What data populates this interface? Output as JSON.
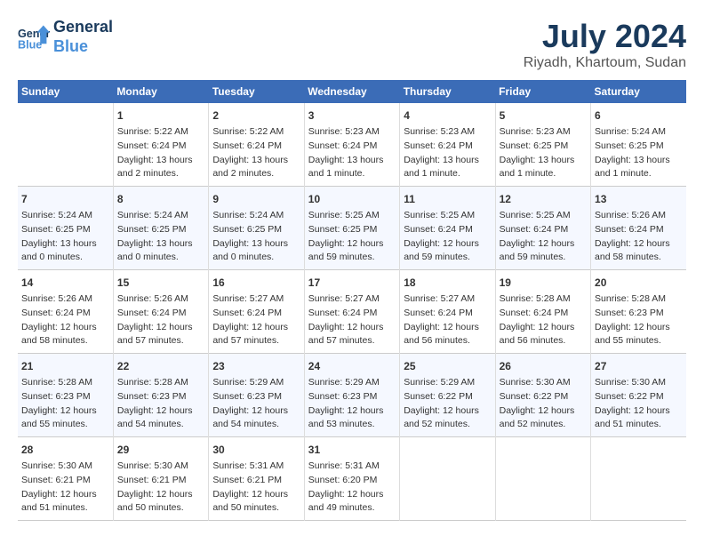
{
  "header": {
    "logo_line1": "General",
    "logo_line2": "Blue",
    "month": "July 2024",
    "location": "Riyadh, Khartoum, Sudan"
  },
  "columns": [
    "Sunday",
    "Monday",
    "Tuesday",
    "Wednesday",
    "Thursday",
    "Friday",
    "Saturday"
  ],
  "weeks": [
    [
      {
        "day": "",
        "info": ""
      },
      {
        "day": "1",
        "info": "Sunrise: 5:22 AM\nSunset: 6:24 PM\nDaylight: 13 hours\nand 2 minutes."
      },
      {
        "day": "2",
        "info": "Sunrise: 5:22 AM\nSunset: 6:24 PM\nDaylight: 13 hours\nand 2 minutes."
      },
      {
        "day": "3",
        "info": "Sunrise: 5:23 AM\nSunset: 6:24 PM\nDaylight: 13 hours\nand 1 minute."
      },
      {
        "day": "4",
        "info": "Sunrise: 5:23 AM\nSunset: 6:24 PM\nDaylight: 13 hours\nand 1 minute."
      },
      {
        "day": "5",
        "info": "Sunrise: 5:23 AM\nSunset: 6:25 PM\nDaylight: 13 hours\nand 1 minute."
      },
      {
        "day": "6",
        "info": "Sunrise: 5:24 AM\nSunset: 6:25 PM\nDaylight: 13 hours\nand 1 minute."
      }
    ],
    [
      {
        "day": "7",
        "info": "Sunrise: 5:24 AM\nSunset: 6:25 PM\nDaylight: 13 hours\nand 0 minutes."
      },
      {
        "day": "8",
        "info": "Sunrise: 5:24 AM\nSunset: 6:25 PM\nDaylight: 13 hours\nand 0 minutes."
      },
      {
        "day": "9",
        "info": "Sunrise: 5:24 AM\nSunset: 6:25 PM\nDaylight: 13 hours\nand 0 minutes."
      },
      {
        "day": "10",
        "info": "Sunrise: 5:25 AM\nSunset: 6:25 PM\nDaylight: 12 hours\nand 59 minutes."
      },
      {
        "day": "11",
        "info": "Sunrise: 5:25 AM\nSunset: 6:24 PM\nDaylight: 12 hours\nand 59 minutes."
      },
      {
        "day": "12",
        "info": "Sunrise: 5:25 AM\nSunset: 6:24 PM\nDaylight: 12 hours\nand 59 minutes."
      },
      {
        "day": "13",
        "info": "Sunrise: 5:26 AM\nSunset: 6:24 PM\nDaylight: 12 hours\nand 58 minutes."
      }
    ],
    [
      {
        "day": "14",
        "info": "Sunrise: 5:26 AM\nSunset: 6:24 PM\nDaylight: 12 hours\nand 58 minutes."
      },
      {
        "day": "15",
        "info": "Sunrise: 5:26 AM\nSunset: 6:24 PM\nDaylight: 12 hours\nand 57 minutes."
      },
      {
        "day": "16",
        "info": "Sunrise: 5:27 AM\nSunset: 6:24 PM\nDaylight: 12 hours\nand 57 minutes."
      },
      {
        "day": "17",
        "info": "Sunrise: 5:27 AM\nSunset: 6:24 PM\nDaylight: 12 hours\nand 57 minutes."
      },
      {
        "day": "18",
        "info": "Sunrise: 5:27 AM\nSunset: 6:24 PM\nDaylight: 12 hours\nand 56 minutes."
      },
      {
        "day": "19",
        "info": "Sunrise: 5:28 AM\nSunset: 6:24 PM\nDaylight: 12 hours\nand 56 minutes."
      },
      {
        "day": "20",
        "info": "Sunrise: 5:28 AM\nSunset: 6:23 PM\nDaylight: 12 hours\nand 55 minutes."
      }
    ],
    [
      {
        "day": "21",
        "info": "Sunrise: 5:28 AM\nSunset: 6:23 PM\nDaylight: 12 hours\nand 55 minutes."
      },
      {
        "day": "22",
        "info": "Sunrise: 5:28 AM\nSunset: 6:23 PM\nDaylight: 12 hours\nand 54 minutes."
      },
      {
        "day": "23",
        "info": "Sunrise: 5:29 AM\nSunset: 6:23 PM\nDaylight: 12 hours\nand 54 minutes."
      },
      {
        "day": "24",
        "info": "Sunrise: 5:29 AM\nSunset: 6:23 PM\nDaylight: 12 hours\nand 53 minutes."
      },
      {
        "day": "25",
        "info": "Sunrise: 5:29 AM\nSunset: 6:22 PM\nDaylight: 12 hours\nand 52 minutes."
      },
      {
        "day": "26",
        "info": "Sunrise: 5:30 AM\nSunset: 6:22 PM\nDaylight: 12 hours\nand 52 minutes."
      },
      {
        "day": "27",
        "info": "Sunrise: 5:30 AM\nSunset: 6:22 PM\nDaylight: 12 hours\nand 51 minutes."
      }
    ],
    [
      {
        "day": "28",
        "info": "Sunrise: 5:30 AM\nSunset: 6:21 PM\nDaylight: 12 hours\nand 51 minutes."
      },
      {
        "day": "29",
        "info": "Sunrise: 5:30 AM\nSunset: 6:21 PM\nDaylight: 12 hours\nand 50 minutes."
      },
      {
        "day": "30",
        "info": "Sunrise: 5:31 AM\nSunset: 6:21 PM\nDaylight: 12 hours\nand 50 minutes."
      },
      {
        "day": "31",
        "info": "Sunrise: 5:31 AM\nSunset: 6:20 PM\nDaylight: 12 hours\nand 49 minutes."
      },
      {
        "day": "",
        "info": ""
      },
      {
        "day": "",
        "info": ""
      },
      {
        "day": "",
        "info": ""
      }
    ]
  ]
}
